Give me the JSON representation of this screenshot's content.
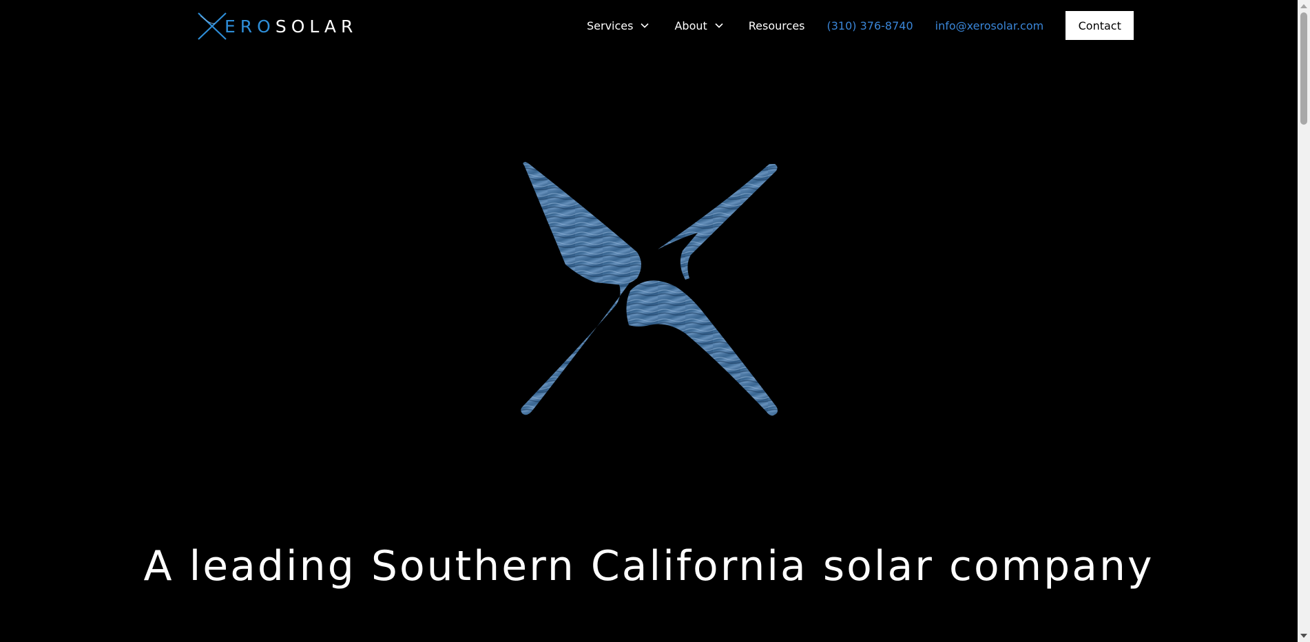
{
  "header": {
    "logo": {
      "x_letter": "X",
      "ero": "ERO",
      "solar": "SOLAR"
    },
    "nav": {
      "services": "Services",
      "about": "About",
      "resources": "Resources",
      "phone": "(310) 376-8740",
      "email": "info@xerosolar.com",
      "contact": "Contact"
    }
  },
  "hero": {
    "mark_icon": "xerosolar-x-icon",
    "headline": "A leading Southern California solar company"
  },
  "colors": {
    "background": "#000000",
    "brand_blue": "#2e8ed8",
    "link_blue": "#3a86d8",
    "text": "#ffffff"
  }
}
